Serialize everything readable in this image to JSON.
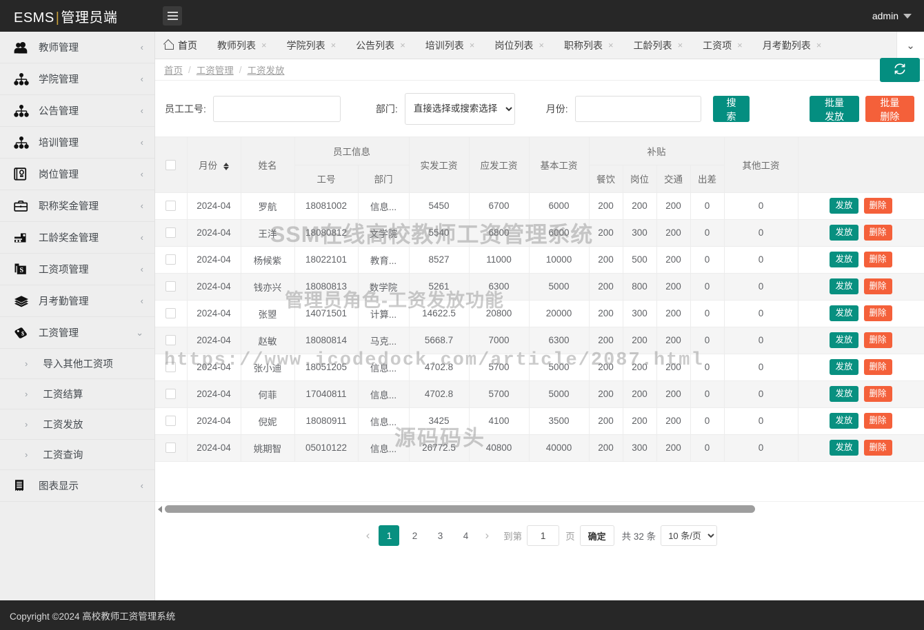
{
  "topbar": {
    "brand_prefix": "ESMS",
    "brand_sep": "|",
    "brand_suffix": "管理员端",
    "menu_icon": "hamburger-icon",
    "user": "admin"
  },
  "sidebar": {
    "items": [
      {
        "label": "教师管理",
        "icon": "users-icon",
        "arrow": "‹"
      },
      {
        "label": "学院管理",
        "icon": "sitemap-icon",
        "arrow": "‹"
      },
      {
        "label": "公告管理",
        "icon": "sitemap-icon",
        "arrow": "‹"
      },
      {
        "label": "培训管理",
        "icon": "sitemap-icon",
        "arrow": "‹"
      },
      {
        "label": "岗位管理",
        "icon": "id-badge-icon",
        "arrow": "‹"
      },
      {
        "label": "职称奖金管理",
        "icon": "briefcase-icon",
        "arrow": "‹"
      },
      {
        "label": "工龄奖金管理",
        "icon": "toolbox-icon",
        "arrow": "‹"
      },
      {
        "label": "工资项管理",
        "icon": "money-note-icon",
        "arrow": "‹"
      },
      {
        "label": "月考勤管理",
        "icon": "layers-icon",
        "arrow": "‹"
      },
      {
        "label": "工资管理",
        "icon": "money-tag-icon",
        "arrow": "⌄"
      }
    ],
    "subitems": [
      {
        "label": "导入其他工资项",
        "arrow": "›"
      },
      {
        "label": "工资结算",
        "arrow": "›"
      },
      {
        "label": "工资发放",
        "arrow": "›"
      },
      {
        "label": "工资查询",
        "arrow": "›"
      }
    ],
    "last_item": {
      "label": "图表显示",
      "icon": "receipt-icon",
      "arrow": "‹"
    }
  },
  "tabs": {
    "home": "首页",
    "items": [
      "教师列表",
      "学院列表",
      "公告列表",
      "培训列表",
      "岗位列表",
      "职称列表",
      "工龄列表",
      "工资项",
      "月考勤列表"
    ],
    "close_glyph": "×",
    "more_glyph": "⌄"
  },
  "breadcrumb": {
    "items": [
      "首页",
      "工资管理",
      "工资发放"
    ],
    "separator": "/",
    "refresh_icon": "refresh-icon"
  },
  "search": {
    "emp_no_label": "员工工号:",
    "emp_no_value": "",
    "emp_no_placeholder": "",
    "dept_label": "部门:",
    "dept_selected": "直接选择或搜索选择",
    "month_label": "月份:",
    "month_value": "",
    "month_placeholder": "",
    "search_button": "搜索",
    "batch_pay_button": "批量发放",
    "batch_delete_button": "批量删除"
  },
  "table": {
    "headers": {
      "month": "月份",
      "name": "姓名",
      "employee_info": "员工信息",
      "emp_no": "工号",
      "dept": "部门",
      "net_pay": "实发工资",
      "gross_pay": "应发工资",
      "base_pay": "基本工资",
      "subsidy": "补贴",
      "meal": "餐饮",
      "post": "岗位",
      "transport": "交通",
      "travel": "出差",
      "other_pay": "其他工资"
    },
    "row_actions": {
      "pay": "发放",
      "delete": "删除"
    },
    "rows": [
      {
        "month": "2024-04",
        "name": "罗航",
        "emp_no": "18081002",
        "dept": "信息...",
        "net_pay": "5450",
        "gross_pay": "6700",
        "base_pay": "6000",
        "meal": "200",
        "post": "200",
        "transport": "200",
        "travel": "0",
        "other_pay": "0"
      },
      {
        "month": "2024-04",
        "name": "王洋",
        "emp_no": "18080812",
        "dept": "文学院",
        "net_pay": "5540",
        "gross_pay": "6800",
        "base_pay": "6000",
        "meal": "200",
        "post": "300",
        "transport": "200",
        "travel": "0",
        "other_pay": "0"
      },
      {
        "month": "2024-04",
        "name": "杨候紫",
        "emp_no": "18022101",
        "dept": "教育...",
        "net_pay": "8527",
        "gross_pay": "11000",
        "base_pay": "10000",
        "meal": "200",
        "post": "500",
        "transport": "200",
        "travel": "0",
        "other_pay": "0"
      },
      {
        "month": "2024-04",
        "name": "钱亦兴",
        "emp_no": "18080813",
        "dept": "数学院",
        "net_pay": "5261",
        "gross_pay": "6300",
        "base_pay": "5000",
        "meal": "200",
        "post": "800",
        "transport": "200",
        "travel": "0",
        "other_pay": "0"
      },
      {
        "month": "2024-04",
        "name": "张曌",
        "emp_no": "14071501",
        "dept": "计算...",
        "net_pay": "14622.5",
        "gross_pay": "20800",
        "base_pay": "20000",
        "meal": "200",
        "post": "300",
        "transport": "200",
        "travel": "0",
        "other_pay": "0"
      },
      {
        "month": "2024-04",
        "name": "赵敏",
        "emp_no": "18080814",
        "dept": "马克...",
        "net_pay": "5668.7",
        "gross_pay": "7000",
        "base_pay": "6300",
        "meal": "200",
        "post": "200",
        "transport": "200",
        "travel": "0",
        "other_pay": "0"
      },
      {
        "month": "2024-04",
        "name": "张小迪",
        "emp_no": "18051205",
        "dept": "信息...",
        "net_pay": "4702.8",
        "gross_pay": "5700",
        "base_pay": "5000",
        "meal": "200",
        "post": "200",
        "transport": "200",
        "travel": "0",
        "other_pay": "0"
      },
      {
        "month": "2024-04",
        "name": "何菲",
        "emp_no": "17040811",
        "dept": "信息...",
        "net_pay": "4702.8",
        "gross_pay": "5700",
        "base_pay": "5000",
        "meal": "200",
        "post": "200",
        "transport": "200",
        "travel": "0",
        "other_pay": "0"
      },
      {
        "month": "2024-04",
        "name": "倪妮",
        "emp_no": "18080911",
        "dept": "信息...",
        "net_pay": "3425",
        "gross_pay": "4100",
        "base_pay": "3500",
        "meal": "200",
        "post": "200",
        "transport": "200",
        "travel": "0",
        "other_pay": "0"
      },
      {
        "month": "2024-04",
        "name": "姚期智",
        "emp_no": "05010122",
        "dept": "信息...",
        "net_pay": "26772.5",
        "gross_pay": "40800",
        "base_pay": "40000",
        "meal": "200",
        "post": "300",
        "transport": "200",
        "travel": "0",
        "other_pay": "0"
      }
    ]
  },
  "pagination": {
    "prev_glyph": "‹",
    "next_glyph": "›",
    "pages": [
      "1",
      "2",
      "3",
      "4"
    ],
    "active_page": "1",
    "goto_label": "到第",
    "goto_value": "1",
    "page_unit": "页",
    "confirm_label": "确定",
    "total_label": "共 32 条",
    "page_size": "10 条/页"
  },
  "footer": {
    "text": "Copyright ©2024 高校教师工资管理系统"
  },
  "watermarks": {
    "line1": "SSM在线高校教师工资管理系统",
    "line2": "管理员角色-工资发放功能",
    "line3": "https://www.icodedock.com/article/2087.html",
    "line4": "源码码头"
  },
  "colors": {
    "teal": "#048e80",
    "orange": "#f4603a",
    "dark": "#272727",
    "sidebar": "#eeeeee"
  }
}
